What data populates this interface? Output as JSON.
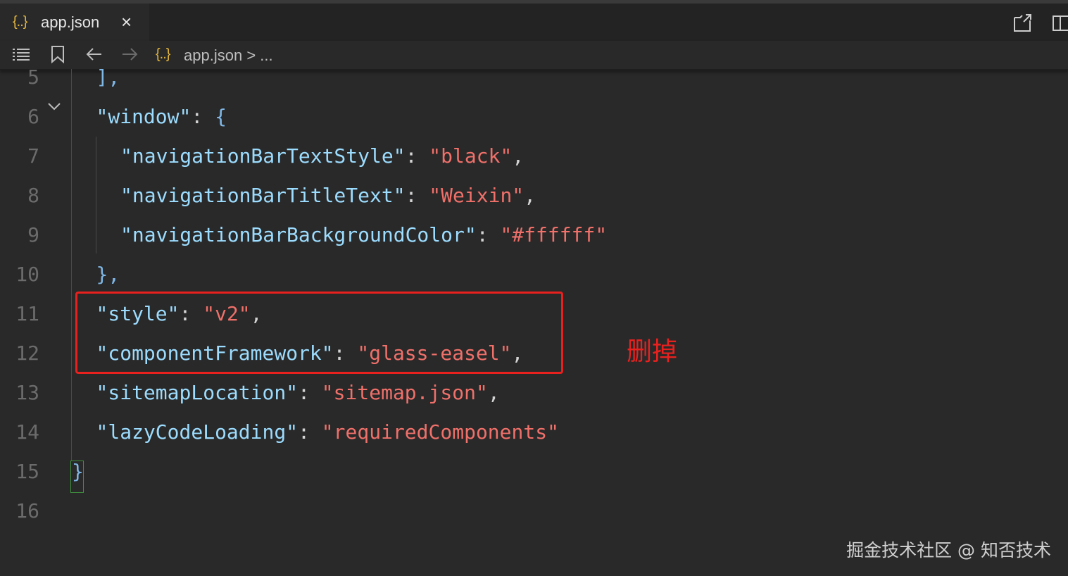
{
  "tab": {
    "icon_text": "{..}",
    "title": "app.json",
    "close": "×"
  },
  "toolbar": {
    "breadcrumb_icon_text": "{..}",
    "breadcrumb_file": "app.json",
    "breadcrumb_sep": ">",
    "breadcrumb_more": "..."
  },
  "icons": {
    "list": "list-icon",
    "bookmark": "bookmark-icon",
    "back": "arrow-left-icon",
    "forward": "arrow-right-icon",
    "open_side": "open-to-side-icon",
    "split": "split-editor-icon",
    "fold": "chevron-down-icon"
  },
  "colors": {
    "key": "#9cdcfe",
    "string": "#f0706a",
    "annotation": "#e8211f",
    "file_icon": "#e2b53d"
  },
  "editor": {
    "lines": [
      {
        "n": "5",
        "indent": 1,
        "parts": [
          {
            "t": "],",
            "c": "b"
          }
        ]
      },
      {
        "n": "6",
        "indent": 1,
        "parts": [
          {
            "t": "\"window\"",
            "c": "k"
          },
          {
            "t": ": ",
            "c": "p"
          },
          {
            "t": "{",
            "c": "b"
          }
        ]
      },
      {
        "n": "7",
        "indent": 2,
        "parts": [
          {
            "t": "\"navigationBarTextStyle\"",
            "c": "k"
          },
          {
            "t": ": ",
            "c": "p"
          },
          {
            "t": "\"black\"",
            "c": "s"
          },
          {
            "t": ",",
            "c": "p"
          }
        ]
      },
      {
        "n": "8",
        "indent": 2,
        "parts": [
          {
            "t": "\"navigationBarTitleText\"",
            "c": "k"
          },
          {
            "t": ": ",
            "c": "p"
          },
          {
            "t": "\"Weixin\"",
            "c": "s"
          },
          {
            "t": ",",
            "c": "p"
          }
        ]
      },
      {
        "n": "9",
        "indent": 2,
        "parts": [
          {
            "t": "\"navigationBarBackgroundColor\"",
            "c": "k"
          },
          {
            "t": ": ",
            "c": "p"
          },
          {
            "t": "\"#ffffff\"",
            "c": "s"
          }
        ]
      },
      {
        "n": "10",
        "indent": 1,
        "parts": [
          {
            "t": "},",
            "c": "b"
          }
        ]
      },
      {
        "n": "11",
        "indent": 1,
        "parts": [
          {
            "t": "\"style\"",
            "c": "k"
          },
          {
            "t": ": ",
            "c": "p"
          },
          {
            "t": "\"v2\"",
            "c": "s"
          },
          {
            "t": ",",
            "c": "p"
          }
        ]
      },
      {
        "n": "12",
        "indent": 1,
        "parts": [
          {
            "t": "\"componentFramework\"",
            "c": "k"
          },
          {
            "t": ": ",
            "c": "p"
          },
          {
            "t": "\"glass-easel\"",
            "c": "s"
          },
          {
            "t": ",",
            "c": "p"
          }
        ]
      },
      {
        "n": "13",
        "indent": 1,
        "parts": [
          {
            "t": "\"sitemapLocation\"",
            "c": "k"
          },
          {
            "t": ": ",
            "c": "p"
          },
          {
            "t": "\"sitemap.json\"",
            "c": "s"
          },
          {
            "t": ",",
            "c": "p"
          }
        ]
      },
      {
        "n": "14",
        "indent": 1,
        "parts": [
          {
            "t": "\"lazyCodeLoading\"",
            "c": "k"
          },
          {
            "t": ": ",
            "c": "p"
          },
          {
            "t": "\"requiredComponents\"",
            "c": "s"
          }
        ]
      },
      {
        "n": "15",
        "indent": 0,
        "parts": [
          {
            "t": "}",
            "c": "b"
          }
        ]
      },
      {
        "n": "16",
        "indent": 0,
        "parts": []
      }
    ]
  },
  "annotation": {
    "text": "删掉"
  },
  "watermark": {
    "text": "掘金技术社区 @ 知否技术"
  }
}
